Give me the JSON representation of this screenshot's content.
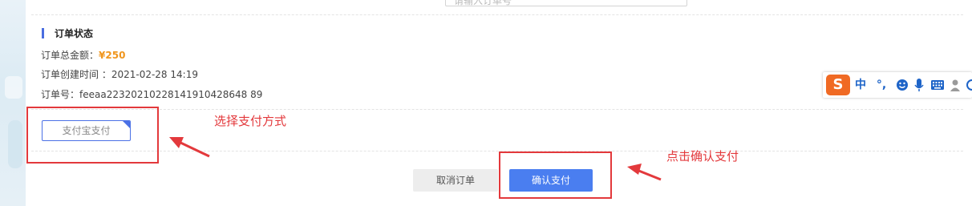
{
  "search": {
    "placeholder": "请输入订单号"
  },
  "order_status": {
    "title": "订单状态",
    "total_label": "订单总金额：",
    "total_value": "¥250",
    "created_label": "订单创建时间 ：",
    "created_value": "2021-02-28 14:19",
    "order_no_label": "订单号：",
    "order_no_value": "feeaa22320210228141910428648 89"
  },
  "payment": {
    "option_label": "支付宝支付"
  },
  "actions": {
    "cancel_label": "取消订单",
    "confirm_label": "确认支付"
  },
  "annotations": {
    "select_method": "选择支付方式",
    "click_confirm": "点击确认支付"
  },
  "ime_toolbar": {
    "logo": "S",
    "lang": "中",
    "punct": "°,",
    "icons": [
      "emoji-icon",
      "microphone-icon",
      "keyboard-icon",
      "user-icon",
      "settings-icon"
    ]
  },
  "colors": {
    "accent": "#4a7ef0",
    "annotation_red": "#e3393c",
    "price_orange": "#f0961e",
    "ime_orange": "#f06a24"
  }
}
